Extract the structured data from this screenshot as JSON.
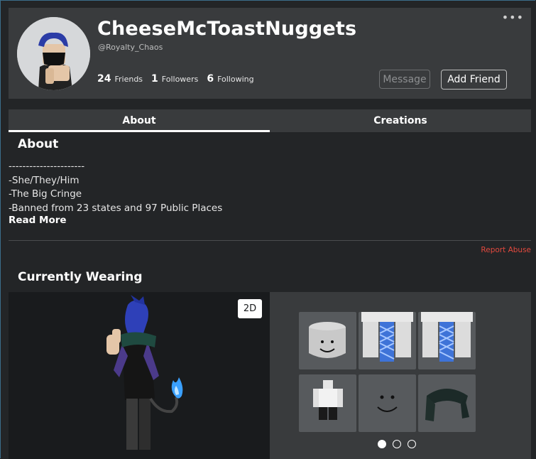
{
  "profile": {
    "display_name": "CheeseMcToastNuggets",
    "username": "@Royalty_Chaos",
    "stats": [
      {
        "count": "24",
        "label": "Friends"
      },
      {
        "count": "1",
        "label": "Followers"
      },
      {
        "count": "6",
        "label": "Following"
      }
    ],
    "more_icon": "more-dots-icon",
    "message_label": "Message",
    "add_friend_label": "Add Friend"
  },
  "tabs": [
    {
      "label": "About",
      "active": true
    },
    {
      "label": "Creations",
      "active": false
    }
  ],
  "about": {
    "heading": "About",
    "description_lines": [
      "----------------------",
      "-She/They/Him",
      "-The Big Cringe",
      "-Banned from 23 states and 97 Public Places"
    ],
    "read_more_label": "Read More",
    "report_label": "Report Abuse"
  },
  "wearing": {
    "heading": "Currently Wearing",
    "view_toggle_label": "2D",
    "items": [
      "hat-head-icon",
      "pants-left-icon",
      "pants-right-icon",
      "torso-figure-icon",
      "smile-face-icon",
      "scarf-icon"
    ],
    "page_count": 3,
    "current_page": 1
  },
  "colors": {
    "background": "#232527",
    "card": "#393b3d",
    "report": "#e2493e"
  }
}
